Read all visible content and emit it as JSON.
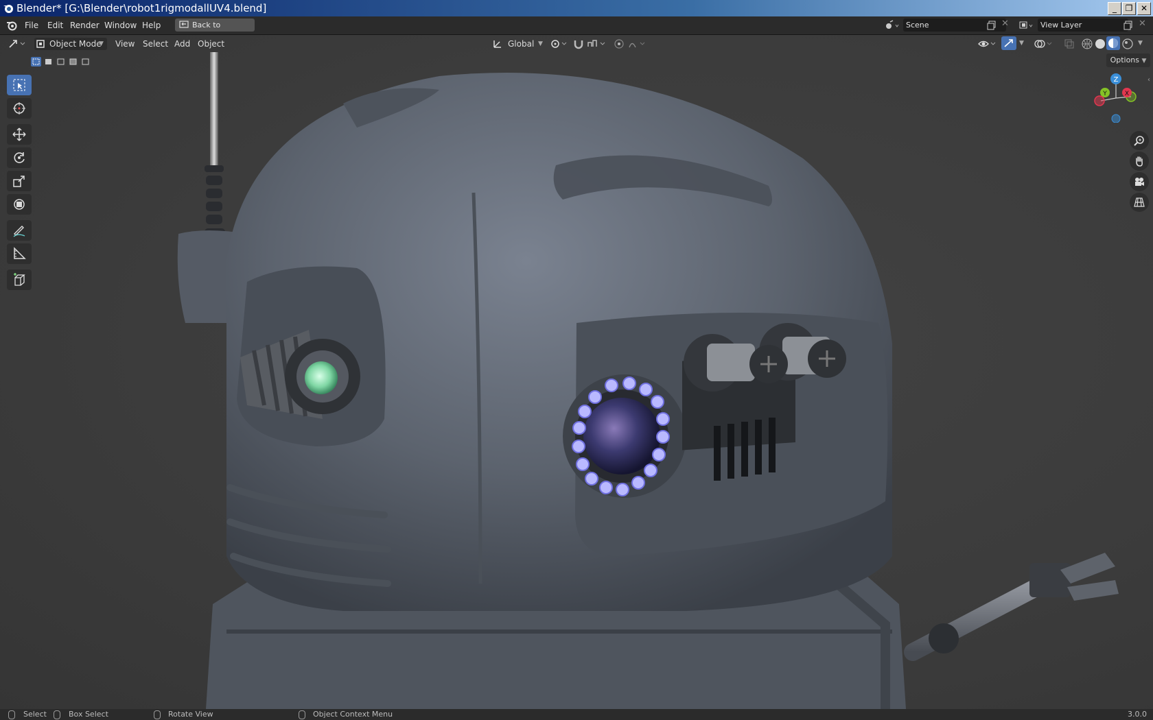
{
  "window": {
    "title": "Blender* [G:\\Blender\\robot1rigmodallUV4.blend]",
    "controls": [
      "_",
      "❐",
      "✕"
    ]
  },
  "menubar": {
    "items": [
      "File",
      "Edit",
      "Render",
      "Window",
      "Help"
    ],
    "back_button": "Back to Previous",
    "scene_label": "Scene",
    "view_layer_label": "View Layer"
  },
  "viewport_header": {
    "mode": "Object Mode",
    "menus": [
      "View",
      "Select",
      "Add",
      "Object"
    ],
    "transform_orientation": "Global",
    "options_label": "Options"
  },
  "toolbar": {
    "tools": [
      "select-box",
      "cursor",
      "move",
      "rotate",
      "scale",
      "transform",
      "annotate",
      "measure",
      "add-cube"
    ],
    "active_tool": "select-box"
  },
  "gizmo": {
    "axes": [
      "Z",
      "Y",
      "X"
    ],
    "colors": {
      "x": "#e2374f",
      "y": "#85c226",
      "z": "#3a8fd9"
    }
  },
  "statusbar": {
    "select": "Select",
    "box_select": "Box Select",
    "rotate_view": "Rotate View",
    "context_menu": "Object Context Menu",
    "version": "3.0.0"
  },
  "colors": {
    "accent": "#4772b3",
    "header": "#2b2b2b",
    "viewport": "#3d3d3d"
  }
}
